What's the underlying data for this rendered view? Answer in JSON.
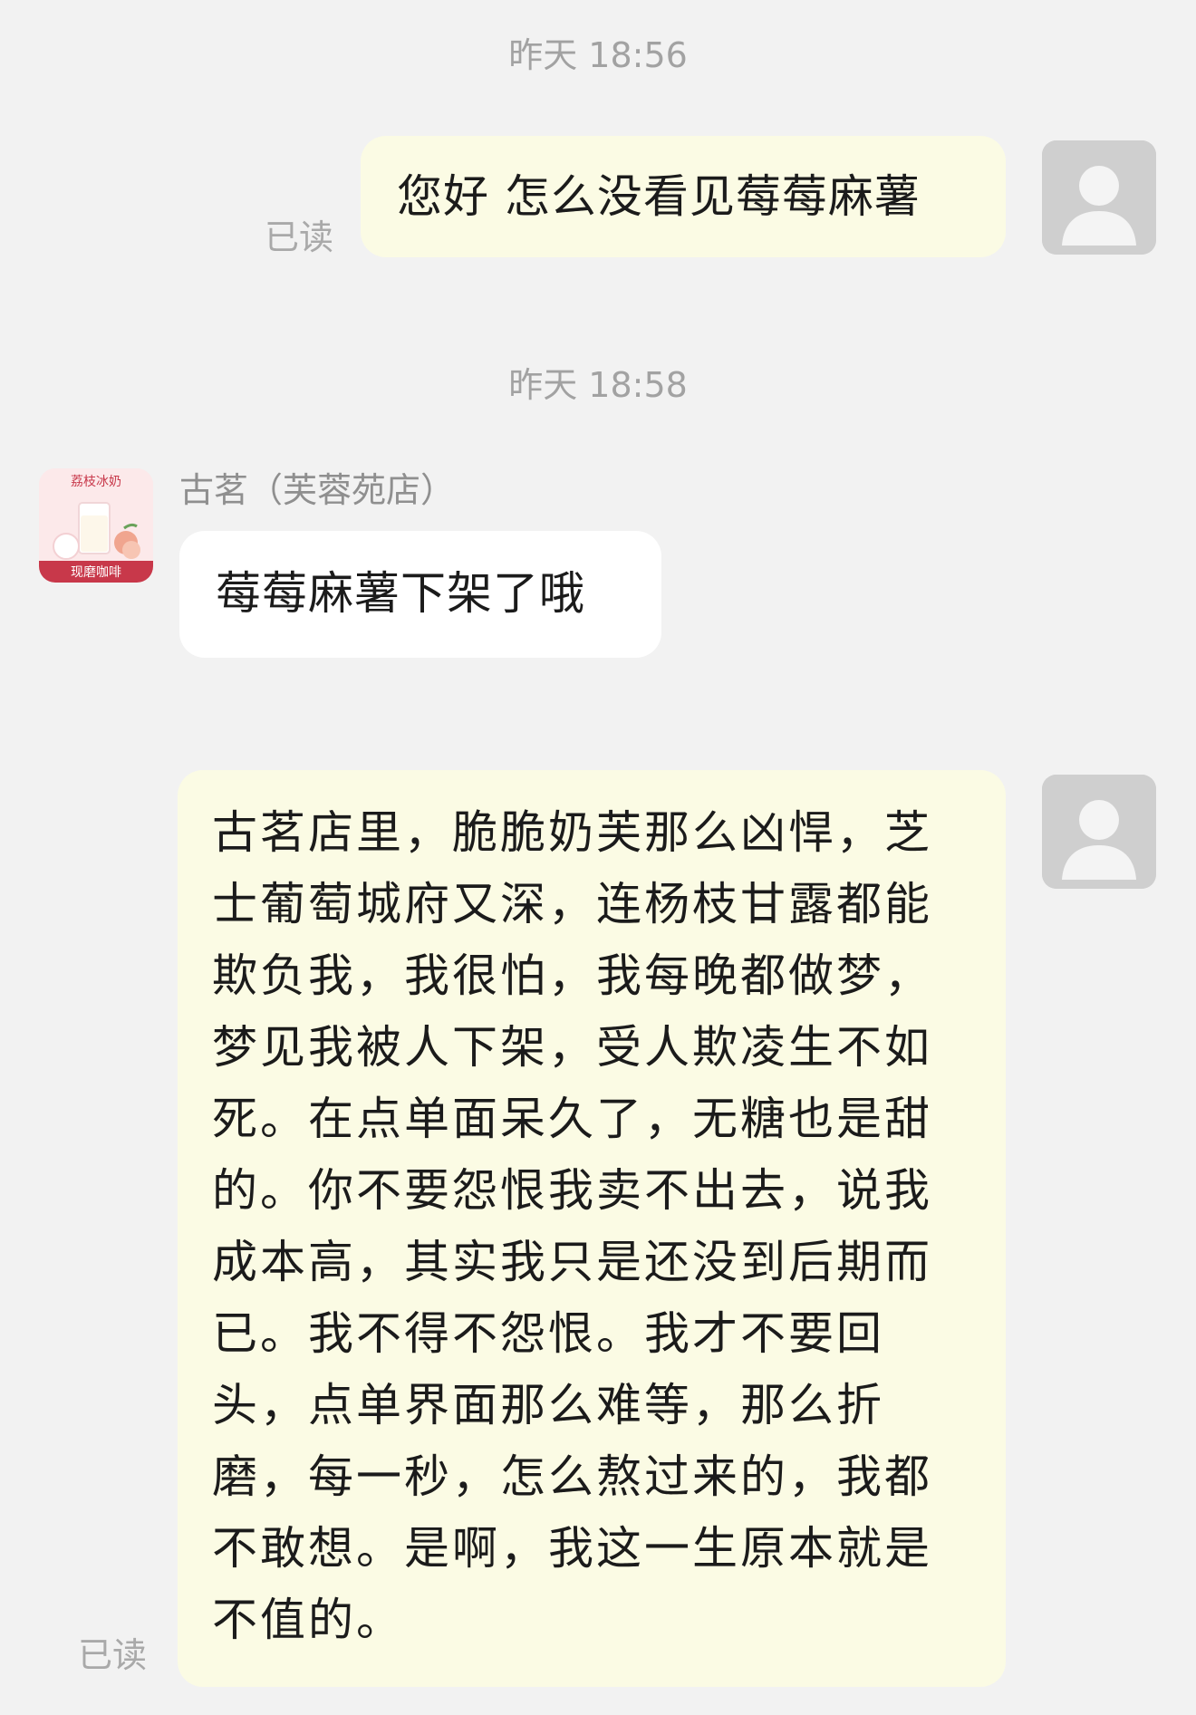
{
  "conversation": {
    "messages": [
      {
        "timestamp": "昨天 18:56",
        "direction": "outgoing",
        "text": "您好 怎么没看见莓莓麻薯",
        "read_status": "已读"
      },
      {
        "timestamp": "昨天 18:58",
        "direction": "incoming",
        "sender": "古茗（芙蓉苑店）",
        "text": "莓莓麻薯下架了哦"
      },
      {
        "direction": "outgoing",
        "text": "古茗店里，脆脆奶芙那么凶悍，芝士葡萄城府又深，连杨枝甘露都能欺负我，我很怕，我每晚都做梦，梦见我被人下架，受人欺凌生不如死。在点单面呆久了，无糖也是甜的。你不要怨恨我卖不出去，说我成本高，其实我只是还没到后期而已。我不得不怨恨。我才不要回头，点单界面那么难等，那么折磨，每一秒，怎么熬过来的，我都不敢想。是啊，我这一生原本就是不值的。",
        "read_status": "已读"
      }
    ],
    "store_avatar": {
      "top_text": "荔枝冰奶",
      "bottom_text": "现磨咖啡"
    }
  },
  "colors": {
    "background": "#f2f2f2",
    "outgoing_bubble": "#fbfbe4",
    "incoming_bubble": "#ffffff",
    "meta_text": "#a2a2a2",
    "store_banner": "#c8384a"
  },
  "icons": {
    "default_avatar": "person-silhouette-icon"
  }
}
